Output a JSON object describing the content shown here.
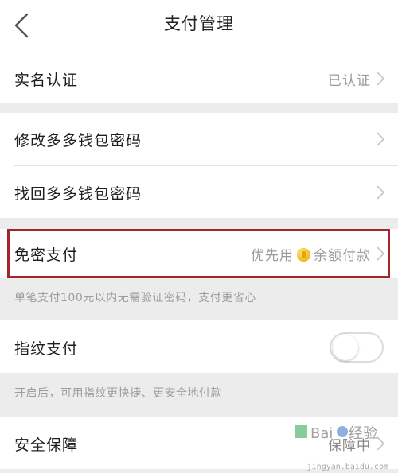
{
  "navbar": {
    "title": "支付管理"
  },
  "rows": {
    "real_name": {
      "label": "实名认证",
      "value": "已认证"
    },
    "modify_password": {
      "label": "修改多多钱包密码"
    },
    "recover_password": {
      "label": "找回多多钱包密码"
    },
    "password_free": {
      "label": "免密支付",
      "value_prefix": "优先用",
      "value_suffix": "余额付款",
      "hint": "单笔支付100元以内无需验证密码，支付更省心"
    },
    "fingerprint": {
      "label": "指纹支付",
      "toggle_on": false,
      "hint": "开启后，可用指纹更快捷、更安全地付款"
    },
    "security": {
      "label": "安全保障",
      "value": "保障中"
    }
  },
  "watermark": {
    "text": "jingyan.baidu.com"
  },
  "colors": {
    "highlight_border": "#a5262a",
    "background": "#ececec",
    "coin": "#f0b81c"
  }
}
